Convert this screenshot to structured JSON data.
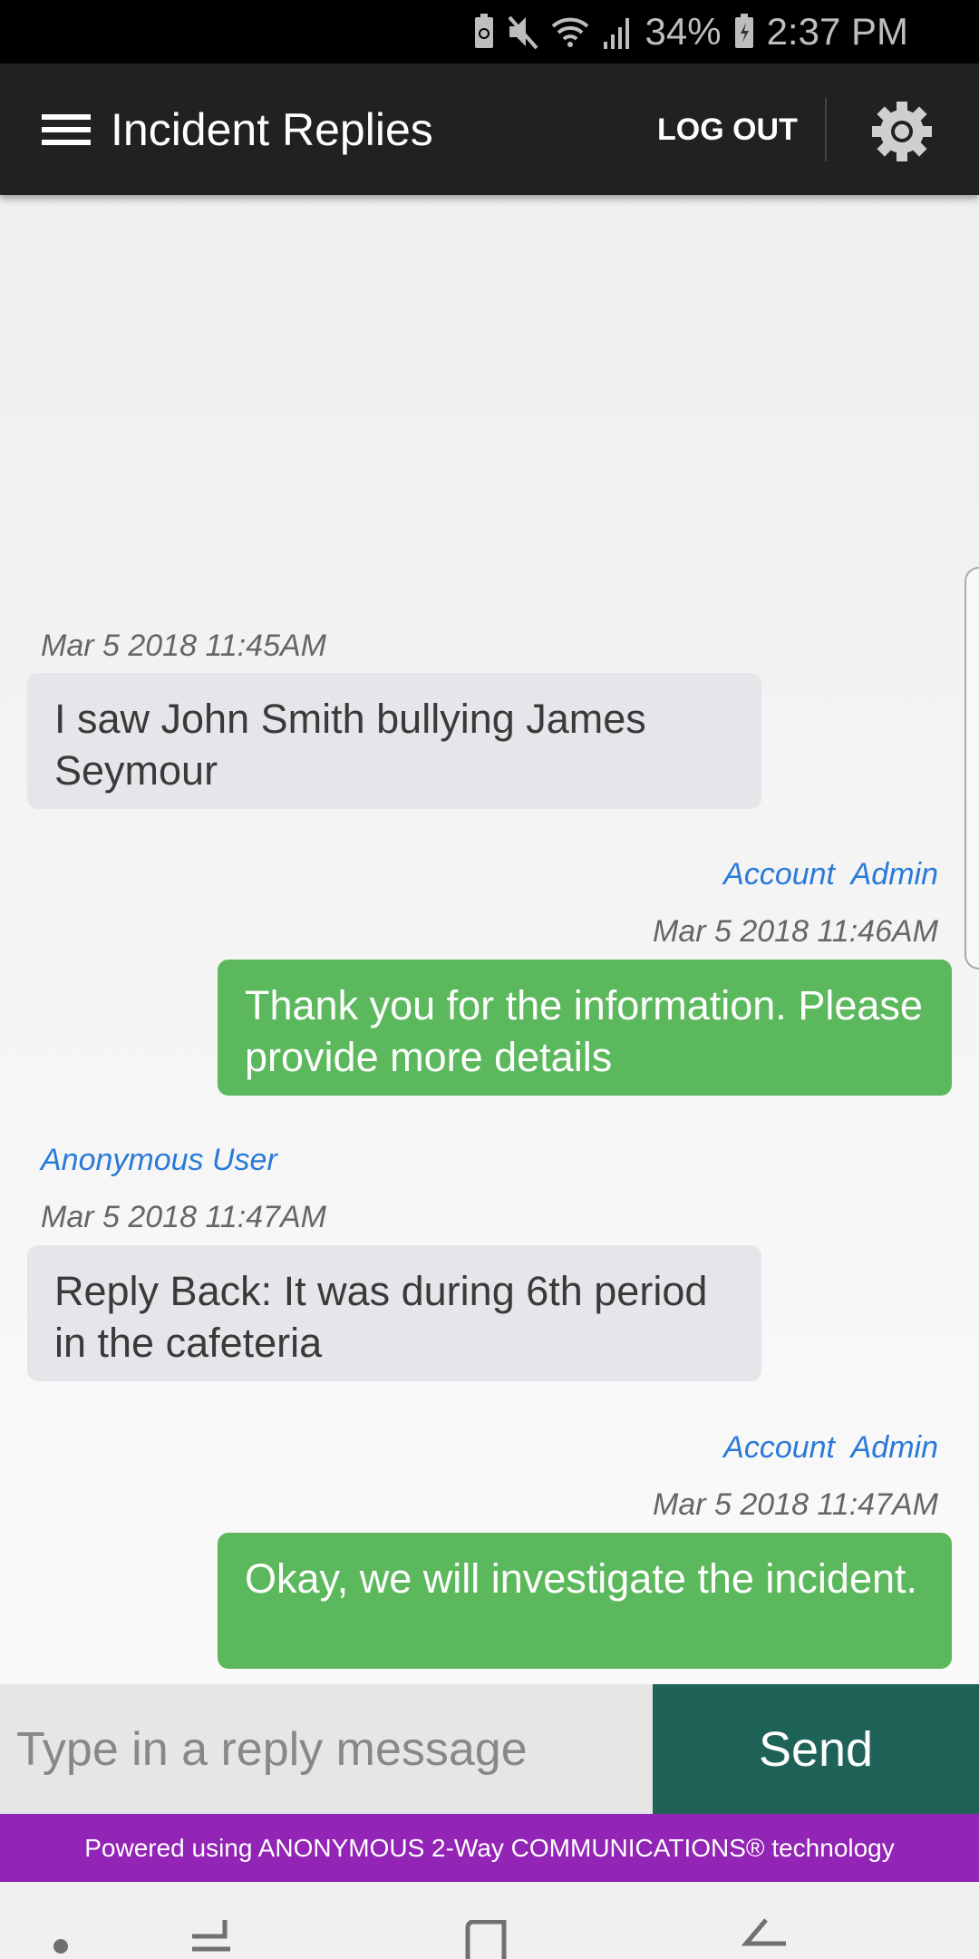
{
  "status_bar": {
    "icons": [
      "battery-saver-icon",
      "mute-icon",
      "wifi-icon",
      "signal-icon",
      "charging-battery-icon"
    ],
    "battery": "34%",
    "time": "2:37 PM"
  },
  "app_bar": {
    "title": "Incident Replies",
    "logout_label": "LOG OUT",
    "menu_icon": "hamburger-menu-icon",
    "settings_icon": "gear-icon"
  },
  "messages": [
    {
      "direction": "incoming",
      "sender": "",
      "timestamp": "Mar 5 2018 11:45AM",
      "text": "I saw John Smith bullying James Seymour"
    },
    {
      "direction": "outgoing",
      "sender": "Account  Admin",
      "timestamp": "Mar 5 2018 11:46AM",
      "text": "Thank you for the information. Please provide more details"
    },
    {
      "direction": "incoming",
      "sender": "Anonymous User",
      "timestamp": "Mar 5 2018 11:47AM",
      "text": "Reply Back: It was during 6th period in the cafeteria"
    },
    {
      "direction": "outgoing",
      "sender": "Account  Admin",
      "timestamp": "Mar 5 2018 11:47AM",
      "text": "Okay, we will investigate the incident."
    }
  ],
  "composer": {
    "placeholder": "Type in a reply message",
    "value": "",
    "send_label": "Send"
  },
  "footer": {
    "text": "Powered using ANONYMOUS 2-Way COMMUNICATIONS® technology"
  },
  "colors": {
    "app_bar": "#212121",
    "outgoing_bubble": "#5cb85c",
    "incoming_bubble": "#e5e6e9",
    "sender_name": "#2a7ad8",
    "send_button": "#1f6358",
    "footer": "#9224b6"
  },
  "nav_bar": {
    "icons": [
      "dot-icon",
      "recents-icon",
      "home-icon",
      "back-icon"
    ]
  }
}
